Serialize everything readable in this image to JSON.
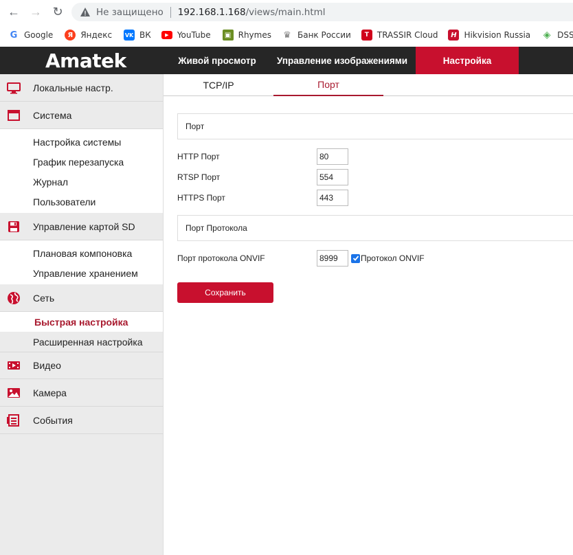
{
  "browser": {
    "not_secure": "Не защищено",
    "url_host": "192.168.1.168",
    "url_path": "/views/main.html",
    "bookmarks": [
      "Google",
      "Яндекс",
      "ВК",
      "YouTube",
      "Rhymes",
      "Банк России",
      "TRASSIR Cloud",
      "Hikvision Russia",
      "DSSL"
    ]
  },
  "app": {
    "logo": "Amatek",
    "nav": [
      "Живой просмотр",
      "Управление изображениями",
      "Настройка"
    ],
    "accent": "#c8102e"
  },
  "sidebar": {
    "local": "Локальные настр.",
    "system": "Система",
    "system_items": [
      "Настройка системы",
      "График перезапуска",
      "Журнал",
      "Пользователи"
    ],
    "sd": "Управление картой SD",
    "sd_items": [
      "Плановая компоновка",
      "Управление хранением"
    ],
    "network": "Сеть",
    "network_items": [
      "Быстрая настройка",
      "Расширенная настройка"
    ],
    "video": "Видео",
    "camera": "Камера",
    "events": "События"
  },
  "tabs": [
    "TCP/IP",
    "Порт"
  ],
  "form": {
    "port_section": "Порт",
    "http_label": "HTTP Порт",
    "http_value": "80",
    "rtsp_label": "RTSP Порт",
    "rtsp_value": "554",
    "https_label": "HTTPS Порт",
    "https_value": "443",
    "protocol_section": "Порт Протокола",
    "onvif_label": "Порт протокола ONVIF",
    "onvif_value": "8999",
    "onvif_checkbox": "Протокол ONVIF",
    "save": "Сохранить"
  }
}
